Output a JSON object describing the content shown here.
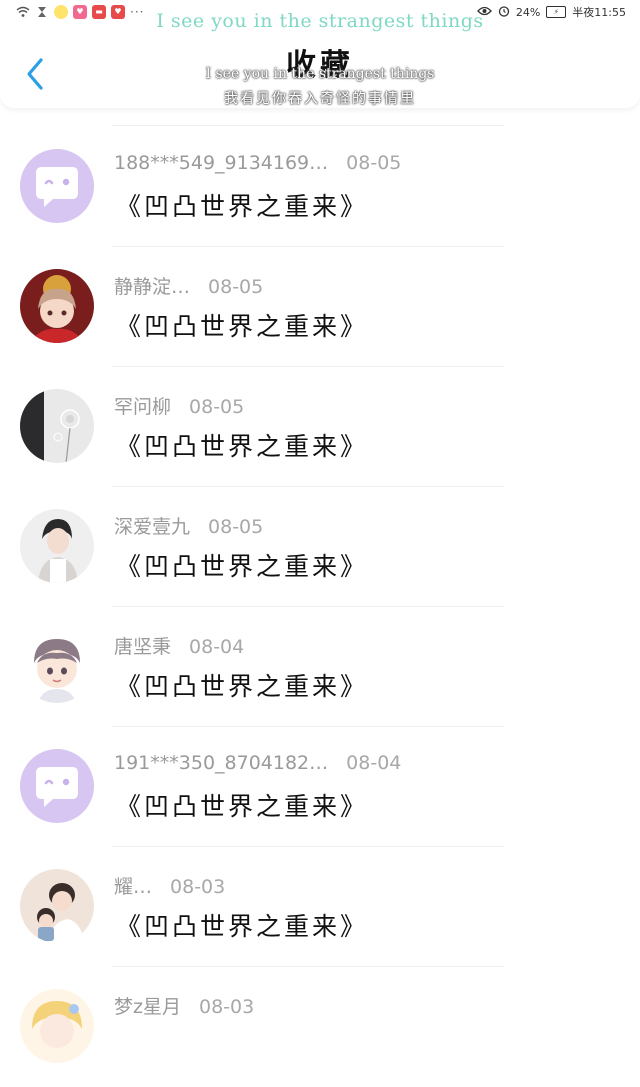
{
  "status_bar": {
    "time": "半夜11:55",
    "battery": "24%",
    "more": "···"
  },
  "lyrics": {
    "top_line": "I see you in the strangest things",
    "en_line": "I see you in the strangest things",
    "cn_line": "我看见你吞入奇怪的事情里"
  },
  "header": {
    "title": "收藏"
  },
  "items": [
    {
      "user": "188***549_9134169…",
      "date": "08-05",
      "title": "《凹凸世界之重来》",
      "avatar": "default-chat"
    },
    {
      "user": "静静淀…",
      "date": "08-05",
      "title": "《凹凸世界之重来》",
      "avatar": "anime-girl-red"
    },
    {
      "user": "罕问柳",
      "date": "08-05",
      "title": "《凹凸世界之重来》",
      "avatar": "dandelion"
    },
    {
      "user": "深爱壹九",
      "date": "08-05",
      "title": "《凹凸世界之重来》",
      "avatar": "person-photo"
    },
    {
      "user": "唐坚秉",
      "date": "08-04",
      "title": "《凹凸世界之重来》",
      "avatar": "cartoon-boy"
    },
    {
      "user": "191***350_8704182…",
      "date": "08-04",
      "title": "《凹凸世界之重来》",
      "avatar": "default-chat"
    },
    {
      "user": "耀…",
      "date": "08-03",
      "title": "《凹凸世界之重来》",
      "avatar": "photo-with-doll"
    },
    {
      "user": "梦z星月",
      "date": "08-03",
      "title": "",
      "avatar": "anime-blonde"
    }
  ],
  "colors": {
    "back_arrow": "#2a9fe8",
    "lyric_green": "#7fd8c4",
    "default_avatar_bg": "#d8c6f2"
  }
}
